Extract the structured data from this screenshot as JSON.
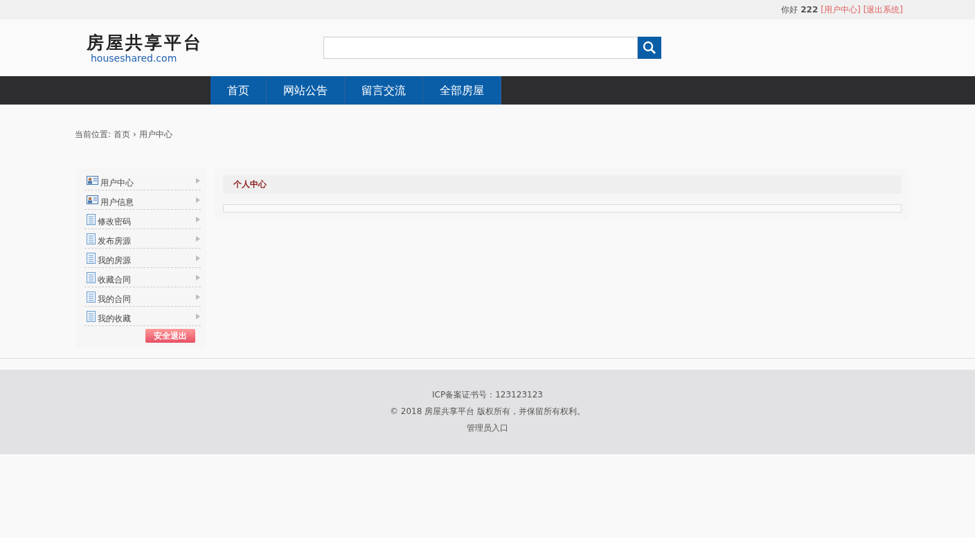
{
  "top_bar": {
    "greeting": "你好",
    "username": "222",
    "links": [
      "[用户中心]",
      "[退出系统]"
    ]
  },
  "logo": {
    "title": "房屋共享平台",
    "domain": "houseshared.com"
  },
  "nav": {
    "items": [
      {
        "label": "首页"
      },
      {
        "label": "网站公告"
      },
      {
        "label": "留言交流"
      },
      {
        "label": "全部房屋"
      }
    ]
  },
  "breadcrumb": {
    "label": "当前位置:",
    "items": [
      "首页",
      "用户中心"
    ],
    "separator": "›"
  },
  "sidebar": {
    "items": [
      {
        "label": "用户中心",
        "kind": "card"
      },
      {
        "label": "用户信息",
        "kind": "card"
      },
      {
        "label": "修改密码",
        "kind": "doc"
      },
      {
        "label": "发布房源",
        "kind": "doc"
      },
      {
        "label": "我的房源",
        "kind": "doc"
      },
      {
        "label": "收藏合同",
        "kind": "doc"
      },
      {
        "label": "我的合同",
        "kind": "doc"
      },
      {
        "label": "我的收藏",
        "kind": "doc"
      }
    ],
    "logout_button": "安全退出"
  },
  "panel": {
    "title": "个人中心"
  },
  "footer": {
    "lines": [
      "ICP备案证书号：123123123",
      "© 2018 房屋共享平台 版权所有，并保留所有权利。"
    ],
    "admin_link": "管理员入口"
  }
}
